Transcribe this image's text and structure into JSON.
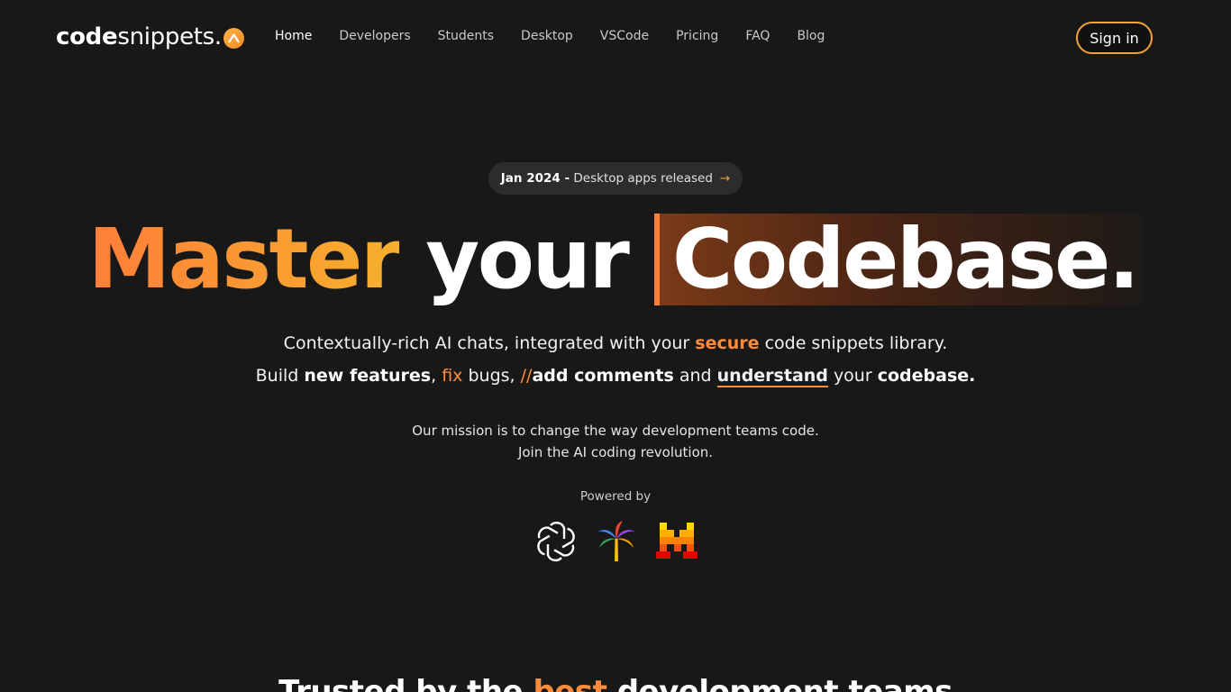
{
  "brand": {
    "name_bold": "code",
    "name_light": "snippets.",
    "accent": "#f0a33c"
  },
  "nav": {
    "items": [
      {
        "label": "Home"
      },
      {
        "label": "Developers"
      },
      {
        "label": "Students"
      },
      {
        "label": "Desktop"
      },
      {
        "label": "VSCode"
      },
      {
        "label": "Pricing"
      },
      {
        "label": "FAQ"
      },
      {
        "label": "Blog"
      }
    ],
    "active": "Home",
    "signin_label": "Sign in"
  },
  "announcement": {
    "date": "Jan 2024 -",
    "text": "Desktop apps released",
    "arrow": "→"
  },
  "hero": {
    "word1": "Master",
    "word2": "your",
    "word3": "Codebase."
  },
  "subtitle1": {
    "pre": "Contextually-rich AI chats, integrated with your",
    "highlight": "secure",
    "post": "code snippets library."
  },
  "subtitle2": {
    "p1": "Build",
    "b1": "new features",
    "p2": ",",
    "fix": "fix",
    "p3": "bugs,",
    "slashes": "//",
    "b2": "add comments",
    "p4": "and",
    "und": "understand",
    "p5": "your",
    "b3": "codebase."
  },
  "mission": {
    "line1": "Our mission is to change the way development teams code.",
    "line2": "Join the AI coding revolution."
  },
  "powered": {
    "label": "Powered by",
    "logos": [
      "openai-icon",
      "palm-icon",
      "mistral-icon"
    ]
  },
  "trusted": {
    "pre": "Trusted by the",
    "highlight": "best",
    "post": "development teams"
  }
}
